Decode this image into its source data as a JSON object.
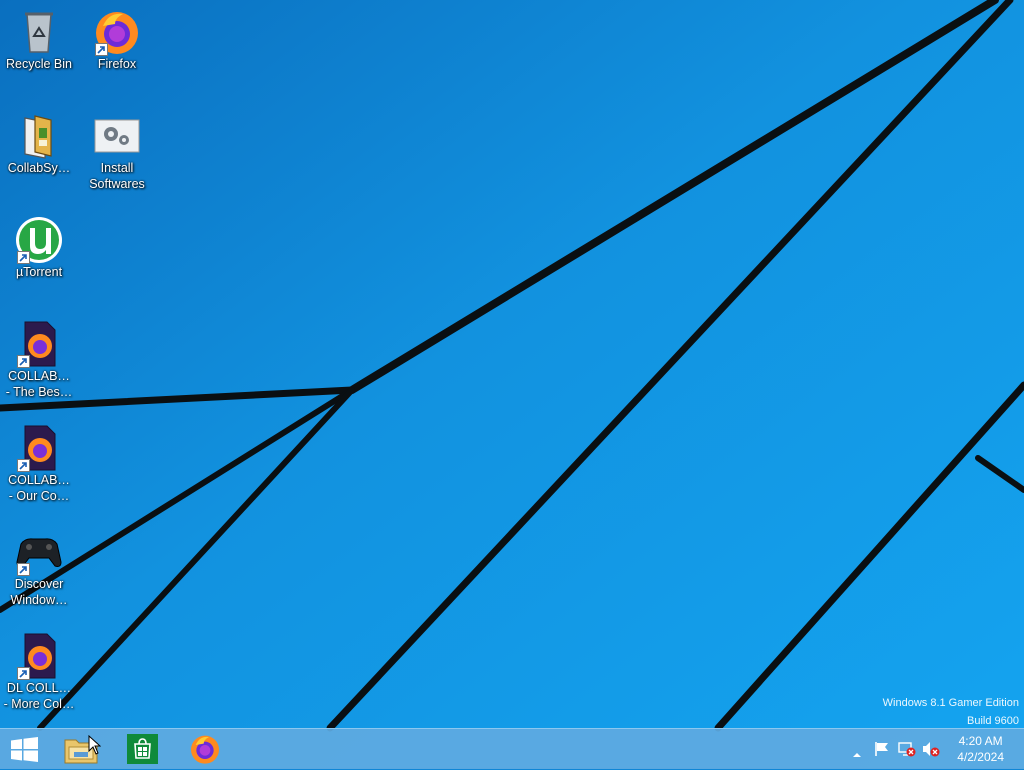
{
  "desktop": {
    "icons": [
      {
        "label": "Recycle Bin",
        "icon": "recycle-bin-icon"
      },
      {
        "label": "Firefox",
        "icon": "firefox-icon"
      },
      {
        "label": "CollabSy…",
        "icon": "folder-icon"
      },
      {
        "label": "Install\nSoftwares",
        "icon": "gears-icon"
      },
      {
        "label": "µTorrent",
        "icon": "utorrent-icon"
      },
      {
        "label": "COLLAB…\n- The Bes…",
        "icon": "firefox-document-icon"
      },
      {
        "label": "COLLAB…\n- Our Co…",
        "icon": "firefox-document-icon"
      },
      {
        "label": "Discover\nWindow…",
        "icon": "gamepad-icon"
      },
      {
        "label": "DL COLL…\n- More Col…",
        "icon": "firefox-document-icon"
      }
    ]
  },
  "watermark": {
    "line1": "Windows 8.1 Gamer Edition",
    "line2": "Build 9600"
  },
  "taskbar": {
    "buttons": [
      "start-icon",
      "file-explorer-icon",
      "store-icon",
      "firefox-icon"
    ],
    "tray": [
      "show-hidden-icons-icon",
      "action-center-flag-icon",
      "network-icon",
      "volume-muted-icon"
    ],
    "clock": {
      "time": "4:20 AM",
      "date": "4/2/2024"
    }
  },
  "colors": {
    "wallpaper": "#0f86d6",
    "taskbar": "#5faae1",
    "lines": "#0a0f12"
  }
}
